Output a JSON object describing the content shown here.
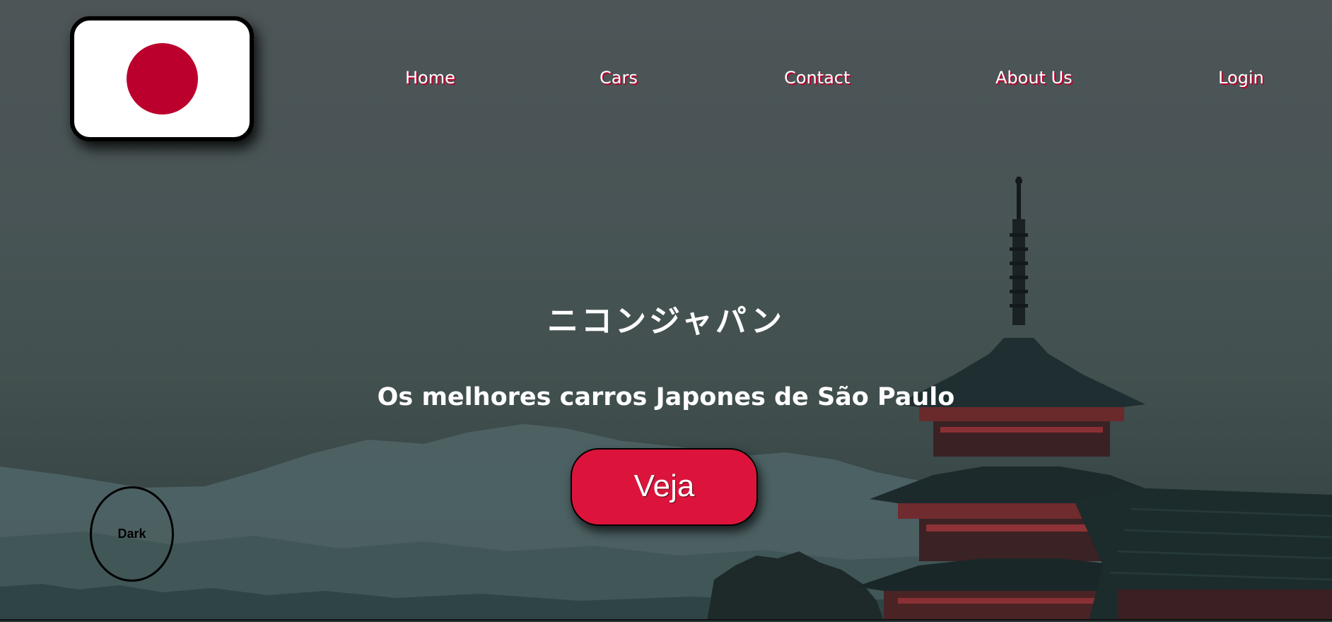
{
  "header": {
    "logo": {
      "icon": "japan-flag-icon"
    },
    "nav": [
      {
        "id": "home",
        "label": "Home"
      },
      {
        "id": "cars",
        "label": "Cars"
      },
      {
        "id": "contact",
        "label": "Contact"
      },
      {
        "id": "about",
        "label": "About Us"
      },
      {
        "id": "login",
        "label": "Login"
      }
    ]
  },
  "hero": {
    "title": "ニコンジャパン",
    "subtitle": "Os melhores carros Japones de São Paulo",
    "cta_label": "Veja"
  },
  "theme_toggle": {
    "label": "Dark"
  },
  "colors": {
    "accent": "#dc143c",
    "flag_red": "#bc002d",
    "text": "#ffffff"
  }
}
